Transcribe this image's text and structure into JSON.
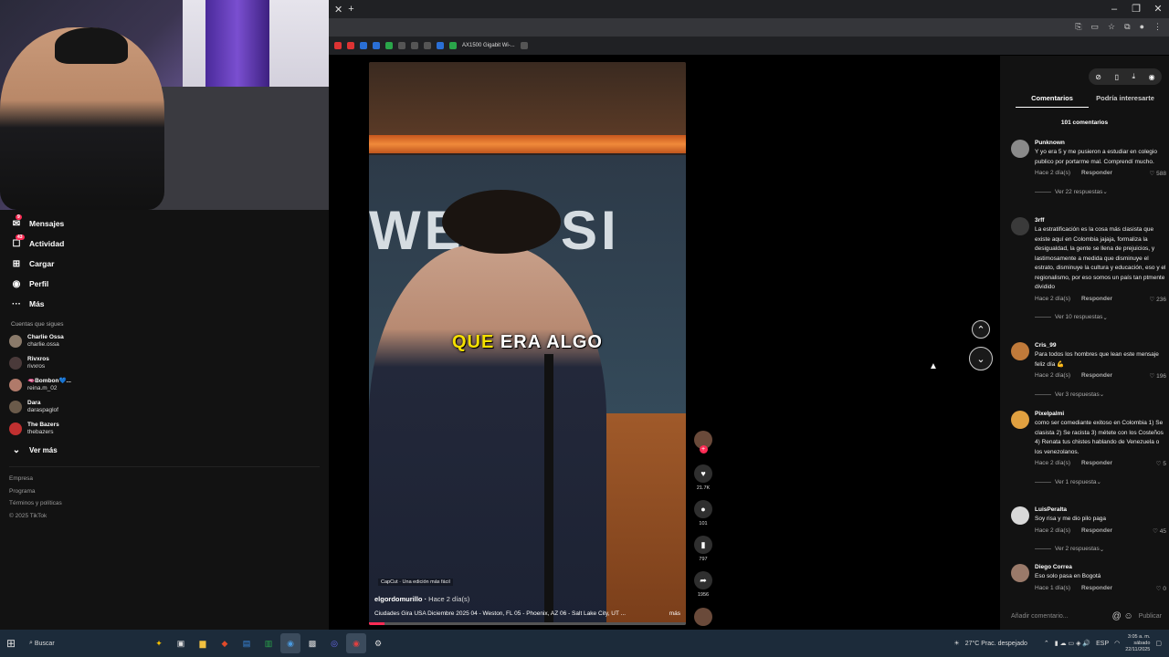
{
  "browser": {
    "new_tab": "+",
    "bookmark_label": "AX1500 Gigabit Wi-..."
  },
  "sidebar": {
    "nav": [
      {
        "label": "Mensajes",
        "badge": "9"
      },
      {
        "label": "Actividad",
        "badge": "43"
      },
      {
        "label": "Cargar"
      },
      {
        "label": "Perfil"
      },
      {
        "label": "Más"
      }
    ],
    "following_title": "Cuentas que sigues",
    "following": [
      {
        "name": "Charlie Ossa",
        "handle": "charlie.ossa"
      },
      {
        "name": "Rivxros",
        "handle": "rivxros"
      },
      {
        "name": "🫦Bombon💙...",
        "handle": "reina.m_02"
      },
      {
        "name": "Dara",
        "handle": "daraspaglof"
      },
      {
        "name": "The Bazers",
        "handle": "thebazers"
      }
    ],
    "see_more": "Ver más",
    "footer": [
      "Empresa",
      "Programa",
      "Términos y políticas",
      "© 2025 TikTok"
    ]
  },
  "video": {
    "caption_yellow": "QUE",
    "caption_white": "ERA ALGO",
    "sign_text": "WEST SI",
    "capcut": "CapCut · Una edición más fácil",
    "author": "elgordomurillo",
    "posted": "Hace 2 día(s)",
    "description": "Ciudades Gira USA Diciembre 2025 04 - Weston, FL 05 - Phoenix, AZ 06 - Salt Lake City, UT ...",
    "more": "más",
    "progress": 0.05
  },
  "actions": {
    "likes": "21.7K",
    "comments": "101",
    "saves": "797",
    "shares": "1956"
  },
  "comments_panel": {
    "tab_active": "Comentarios",
    "tab_other": "Podría interesarte",
    "count_label": "101 comentarios",
    "reply_label": "Responder",
    "add_placeholder": "Añadir comentario...",
    "publish": "Publicar",
    "comments": [
      {
        "user": "Punknown",
        "text": "Y yo era 5 y me pusieron a estudiar en colegio publico por portarme mal. Comprendí mucho.",
        "time": "Hace 2 día(s)",
        "likes": "588",
        "replies": "Ver 22 respuestas",
        "avatar_color": "#8a8a8a"
      },
      {
        "user": "3rff",
        "text": "La estratificación es la cosa más clasista que existe aquí en Colombia jajaja, formaliza la desigualdad, la gente se llena de prejuicios, y lastimosamente a medida que disminuye el estrato, disminuye la cultura y educación, eso y el regionalismo, por eso somos un país tan ptmente dividido",
        "time": "Hace 2 día(s)",
        "likes": "236",
        "replies": "Ver 10 respuestas",
        "avatar_color": "#3a3a3a"
      },
      {
        "user": "Cris_99",
        "text": "Para todos los hombres que lean este mensaje feliz día 💪",
        "time": "Hace 2 día(s)",
        "likes": "196",
        "replies": "Ver 3 respuestas",
        "avatar_color": "#c07a3a"
      },
      {
        "user": "Pixelpalmi",
        "text": "como ser comediante exitoso en Colombia 1) Se clasista 2) Se racista 3) métete con los Costeños 4) Renata tus chistes hablando de Venezuela o los venezolanos.",
        "time": "Hace 2 día(s)",
        "likes": "5",
        "replies": "Ver 1 respuesta",
        "avatar_color": "#e0a040"
      },
      {
        "user": "LuisPeralta",
        "text": "Soy risa y me dio pilo paga",
        "time": "Hace 2 día(s)",
        "likes": "45",
        "replies": "Ver 2 respuestas",
        "avatar_color": "#d8d8d8"
      },
      {
        "user": "Diego Correa",
        "text": "Eso solo pasa en Bogotá",
        "time": "Hace 1 día(s)",
        "likes": "0",
        "replies": "",
        "avatar_color": "#9a7a6a"
      }
    ]
  },
  "taskbar": {
    "search": "Buscar",
    "weather": "27°C  Prac. despejado",
    "lang": "ESP",
    "time": "3:05 a. m.",
    "day": "sábado",
    "date": "22/11/2025"
  }
}
